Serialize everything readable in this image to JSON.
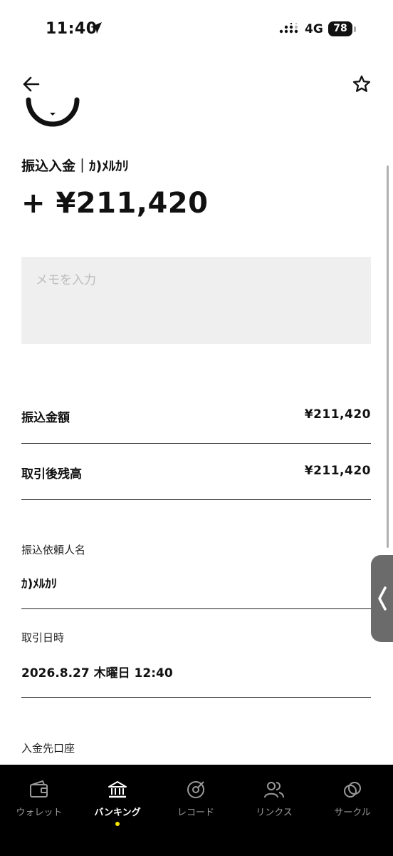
{
  "status_bar": {
    "time": "11:40",
    "network": "4G",
    "battery": "78"
  },
  "transaction": {
    "title": "振込入金｜ｶ)ﾒﾙｶﾘ",
    "amount": "+ ¥211,420",
    "memo_placeholder": "メモを入力",
    "memo_value": ""
  },
  "summary": [
    {
      "label": "振込金額",
      "value": "¥211,420"
    },
    {
      "label": "取引後残高",
      "value": "¥211,420"
    }
  ],
  "details": [
    {
      "label": "振込依頼人名",
      "value": "ｶ)ﾒﾙｶﾘ"
    },
    {
      "label": "取引日時",
      "value": "2026.8.27 木曜日 12:40"
    },
    {
      "label": "入金先口座",
      "value": ""
    }
  ],
  "tabbar": {
    "items": [
      {
        "label": "ウォレット",
        "icon": "wallet-icon",
        "active": false
      },
      {
        "label": "バンキング",
        "icon": "bank-icon",
        "active": true
      },
      {
        "label": "レコード",
        "icon": "record-icon",
        "active": false
      },
      {
        "label": "リンクス",
        "icon": "people-icon",
        "active": false
      },
      {
        "label": "サークル",
        "icon": "circle-link-icon",
        "active": false
      }
    ],
    "active_dot_color": "#f3e500"
  }
}
